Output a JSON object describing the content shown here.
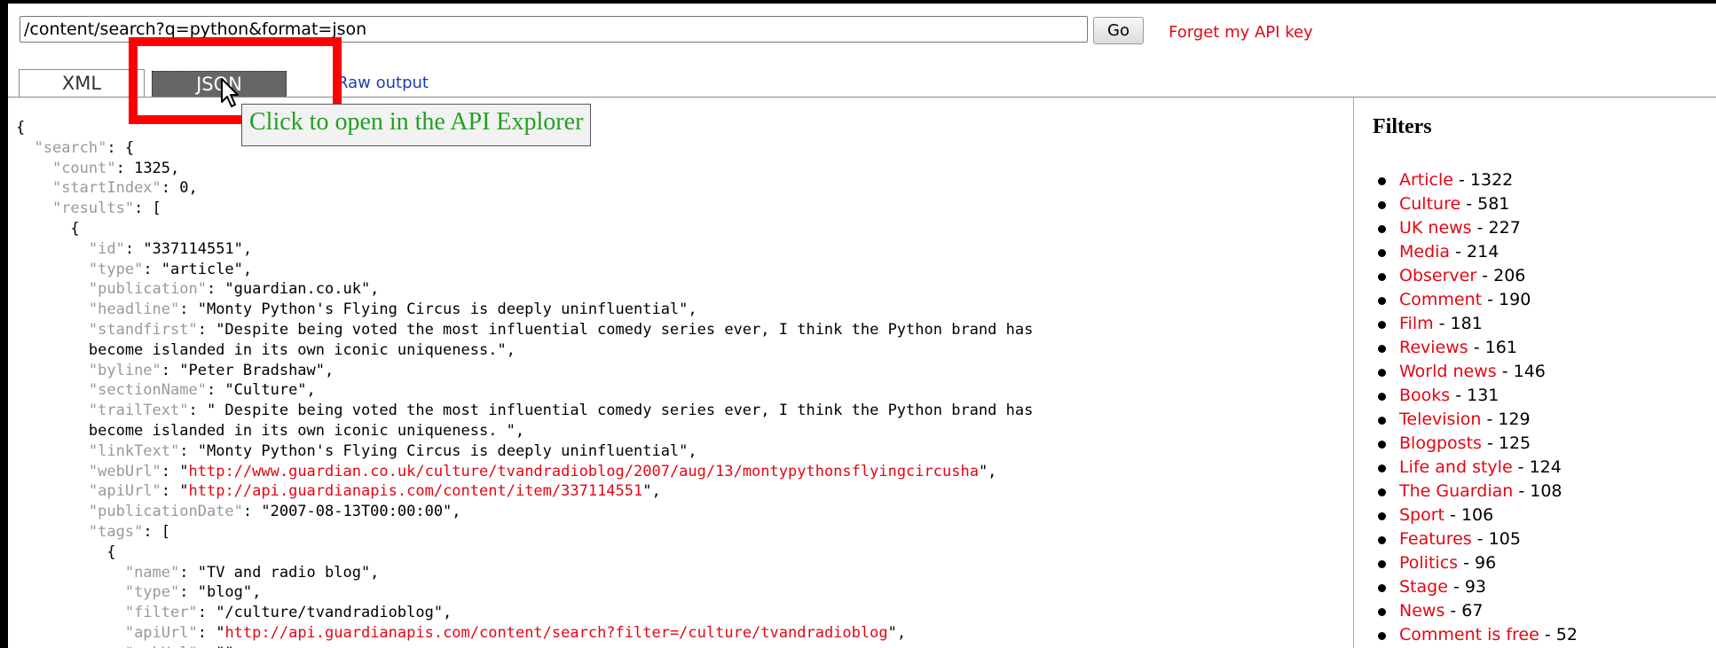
{
  "toolbar": {
    "url_value": "/content/search?q=python&format=json",
    "go_label": "Go",
    "forget_label": "Forget my API key"
  },
  "tabs": {
    "xml_label": "XML",
    "json_label": "JSON",
    "raw_label": "Raw output"
  },
  "tooltip": "Click to open in the API Explorer",
  "json_lines": [
    [
      {
        "t": "{"
      }
    ],
    [
      {
        "t": "  "
      },
      {
        "t": "\"search\"",
        "c": "k"
      },
      {
        "t": ": {"
      }
    ],
    [
      {
        "t": "    "
      },
      {
        "t": "\"count\"",
        "c": "k"
      },
      {
        "t": ": 1325,"
      }
    ],
    [
      {
        "t": "    "
      },
      {
        "t": "\"startIndex\"",
        "c": "k"
      },
      {
        "t": ": 0,"
      }
    ],
    [
      {
        "t": "    "
      },
      {
        "t": "\"results\"",
        "c": "k"
      },
      {
        "t": ": ["
      }
    ],
    [
      {
        "t": "      {"
      }
    ],
    [
      {
        "t": "        "
      },
      {
        "t": "\"id\"",
        "c": "k"
      },
      {
        "t": ": \"337114551\","
      }
    ],
    [
      {
        "t": "        "
      },
      {
        "t": "\"type\"",
        "c": "k"
      },
      {
        "t": ": \"article\","
      }
    ],
    [
      {
        "t": "        "
      },
      {
        "t": "\"publication\"",
        "c": "k"
      },
      {
        "t": ": \"guardian.co.uk\","
      }
    ],
    [
      {
        "t": "        "
      },
      {
        "t": "\"headline\"",
        "c": "k"
      },
      {
        "t": ": \"Monty Python's Flying Circus is deeply uninfluential\","
      }
    ],
    [
      {
        "t": "        "
      },
      {
        "t": "\"standfirst\"",
        "c": "k"
      },
      {
        "t": ": \"Despite being voted the most influential comedy series ever, I think the Python brand has"
      }
    ],
    [
      {
        "t": "        become islanded in its own iconic uniqueness.\","
      }
    ],
    [
      {
        "t": "        "
      },
      {
        "t": "\"byline\"",
        "c": "k"
      },
      {
        "t": ": \"Peter Bradshaw\","
      }
    ],
    [
      {
        "t": "        "
      },
      {
        "t": "\"sectionName\"",
        "c": "k"
      },
      {
        "t": ": \"Culture\","
      }
    ],
    [
      {
        "t": "        "
      },
      {
        "t": "\"trailText\"",
        "c": "k"
      },
      {
        "t": ": \" Despite being voted the most influential comedy series ever, I think the Python brand has"
      }
    ],
    [
      {
        "t": "        become islanded in its own iconic uniqueness. \","
      }
    ],
    [
      {
        "t": "        "
      },
      {
        "t": "\"linkText\"",
        "c": "k"
      },
      {
        "t": ": \"Monty Python's Flying Circus is deeply uninfluential\","
      }
    ],
    [
      {
        "t": "        "
      },
      {
        "t": "\"webUrl\"",
        "c": "k"
      },
      {
        "t": ": \""
      },
      {
        "t": "http://www.guardian.co.uk/culture/tvandradioblog/2007/aug/13/montypythonsflyingcircusha",
        "c": "u"
      },
      {
        "t": "\","
      }
    ],
    [
      {
        "t": "        "
      },
      {
        "t": "\"apiUrl\"",
        "c": "k"
      },
      {
        "t": ": \""
      },
      {
        "t": "http://api.guardianapis.com/content/item/337114551",
        "c": "u"
      },
      {
        "t": "\","
      }
    ],
    [
      {
        "t": "        "
      },
      {
        "t": "\"publicationDate\"",
        "c": "k"
      },
      {
        "t": ": \"2007-08-13T00:00:00\","
      }
    ],
    [
      {
        "t": "        "
      },
      {
        "t": "\"tags\"",
        "c": "k"
      },
      {
        "t": ": ["
      }
    ],
    [
      {
        "t": "          {"
      }
    ],
    [
      {
        "t": "            "
      },
      {
        "t": "\"name\"",
        "c": "k"
      },
      {
        "t": ": \"TV and radio blog\","
      }
    ],
    [
      {
        "t": "            "
      },
      {
        "t": "\"type\"",
        "c": "k"
      },
      {
        "t": ": \"blog\","
      }
    ],
    [
      {
        "t": "            "
      },
      {
        "t": "\"filter\"",
        "c": "k"
      },
      {
        "t": ": \"/culture/tvandradioblog\","
      }
    ],
    [
      {
        "t": "            "
      },
      {
        "t": "\"apiUrl\"",
        "c": "k"
      },
      {
        "t": ": \""
      },
      {
        "t": "http://api.guardianapis.com/content/search?filter=/culture/tvandradioblog",
        "c": "u"
      },
      {
        "t": "\","
      }
    ],
    [
      {
        "t": "            "
      },
      {
        "t": "\"webUrl\"",
        "c": "k"
      },
      {
        "t": ": \"\""
      }
    ]
  ],
  "filters": {
    "title": "Filters",
    "items": [
      {
        "name": "Article",
        "count": " - 1322"
      },
      {
        "name": "Culture",
        "count": " - 581"
      },
      {
        "name": "UK news",
        "count": " - 227"
      },
      {
        "name": "Media",
        "count": " - 214"
      },
      {
        "name": "Observer",
        "count": " - 206"
      },
      {
        "name": "Comment",
        "count": " - 190"
      },
      {
        "name": "Film",
        "count": " - 181"
      },
      {
        "name": "Reviews",
        "count": " - 161"
      },
      {
        "name": "World news",
        "count": " - 146"
      },
      {
        "name": "Books",
        "count": " - 131"
      },
      {
        "name": "Television",
        "count": " - 129"
      },
      {
        "name": "Blogposts",
        "count": " - 125"
      },
      {
        "name": "Life and style",
        "count": " - 124"
      },
      {
        "name": "The Guardian",
        "count": " - 108"
      },
      {
        "name": "Sport",
        "count": " - 106"
      },
      {
        "name": "Features",
        "count": " - 105"
      },
      {
        "name": "Politics",
        "count": " - 96"
      },
      {
        "name": "Stage",
        "count": " - 93"
      },
      {
        "name": "News",
        "count": " - 67"
      },
      {
        "name": "Comment is free",
        "count": " - 52"
      }
    ]
  },
  "colors": {
    "link_red": "#e30613",
    "highlight_red": "#ff0000",
    "tooltip_green": "#22a022",
    "key_gray": "#999999",
    "raw_link_blue": "#1a3fb0"
  }
}
